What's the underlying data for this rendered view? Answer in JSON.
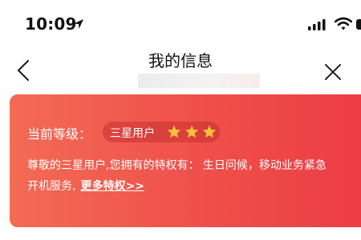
{
  "status_bar": {
    "time": "10:09",
    "icons": [
      "location-arrow-icon",
      "signal-icon",
      "wifi-icon",
      "battery-icon"
    ]
  },
  "nav": {
    "title": "我的信息",
    "back_icon": "chevron-left-icon",
    "close_icon": "close-icon"
  },
  "card": {
    "level_label": "当前等级：",
    "level_value": "三星用户",
    "stars": 3,
    "privilege_text": "尊敬的三星用户,您拥有的特权有：  生日问候，移动业务紧急",
    "privilege_text_2": "开机服务,",
    "more_link": "更多特权>>",
    "colors": {
      "gradient_start": "#f36b55",
      "gradient_end": "#ec3b43",
      "star": "#f7c03b"
    }
  },
  "bottom": {
    "peek_text": ""
  }
}
